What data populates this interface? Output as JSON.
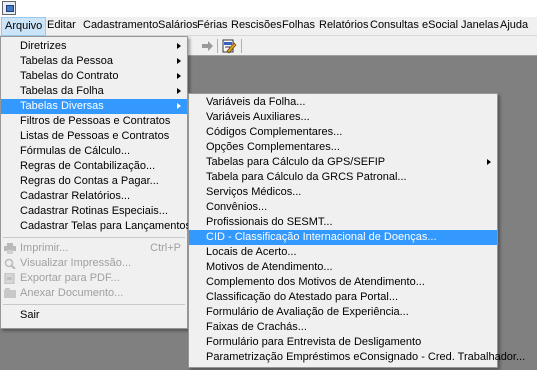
{
  "menubar": {
    "items": [
      "Arquivo",
      "Editar",
      "Cadastramento",
      "Salários",
      "Férias",
      "Rescisões",
      "Folhas",
      "Relatórios",
      "Consultas",
      "eSocial",
      "Janelas",
      "Ajuda"
    ]
  },
  "toolbar": {
    "icons": [
      "arrow-right-icon",
      "document-edit-icon"
    ]
  },
  "arquivo_menu": {
    "items": [
      {
        "label": "Diretrizes",
        "submenu": true
      },
      {
        "label": "Tabelas da Pessoa",
        "submenu": true
      },
      {
        "label": "Tabelas do Contrato",
        "submenu": true
      },
      {
        "label": "Tabelas da Folha",
        "submenu": true
      },
      {
        "label": "Tabelas Diversas",
        "submenu": true
      },
      {
        "label": "Filtros de Pessoas e Contratos"
      },
      {
        "label": "Listas de Pessoas e Contratos"
      },
      {
        "label": "Fórmulas de Cálculo..."
      },
      {
        "label": "Regras de Contabilização..."
      },
      {
        "label": "Regras do Contas a Pagar..."
      },
      {
        "label": "Cadastrar Relatórios..."
      },
      {
        "label": "Cadastrar Rotinas Especiais..."
      },
      {
        "label": "Cadastrar Telas para Lançamentos..."
      }
    ],
    "print_items": [
      {
        "label": "Imprimir...",
        "shortcut": "Ctrl+P",
        "icon": "printer-icon"
      },
      {
        "label": "Visualizar Impressão...",
        "icon": "print-preview-icon"
      },
      {
        "label": "Exportar para PDF...",
        "icon": "export-pdf-icon"
      },
      {
        "label": "Anexar Documento...",
        "icon": "attach-document-icon"
      }
    ],
    "exit_label": "Sair"
  },
  "tabelas_diversas_menu": {
    "items": [
      {
        "label": "Variáveis da Folha..."
      },
      {
        "label": "Variáveis Auxiliares..."
      },
      {
        "label": "Códigos Complementares..."
      },
      {
        "label": "Opções Complementares..."
      },
      {
        "label": "Tabelas para Cálculo da GPS/SEFIP",
        "submenu": true
      },
      {
        "label": "Tabela para Cálculo da GRCS Patronal..."
      },
      {
        "label": "Serviços Médicos..."
      },
      {
        "label": "Convênios..."
      },
      {
        "label": "Profissionais do SESMT..."
      },
      {
        "label": "CID - Classificação Internacional de Doenças...",
        "highlighted": true
      },
      {
        "label": "Locais de Acerto..."
      },
      {
        "label": "Motivos de Atendimento..."
      },
      {
        "label": "Complemento dos Motivos de Atendimento..."
      },
      {
        "label": "Classificação do Atestado para Portal..."
      },
      {
        "label": "Formulário de Avaliação de Experiência..."
      },
      {
        "label": "Faixas de Crachás..."
      },
      {
        "label": "Formulário para Entrevista de Desligamento"
      },
      {
        "label": "Parametrização Empréstimos eConsignado - Cred. Trabalhador..."
      }
    ]
  }
}
